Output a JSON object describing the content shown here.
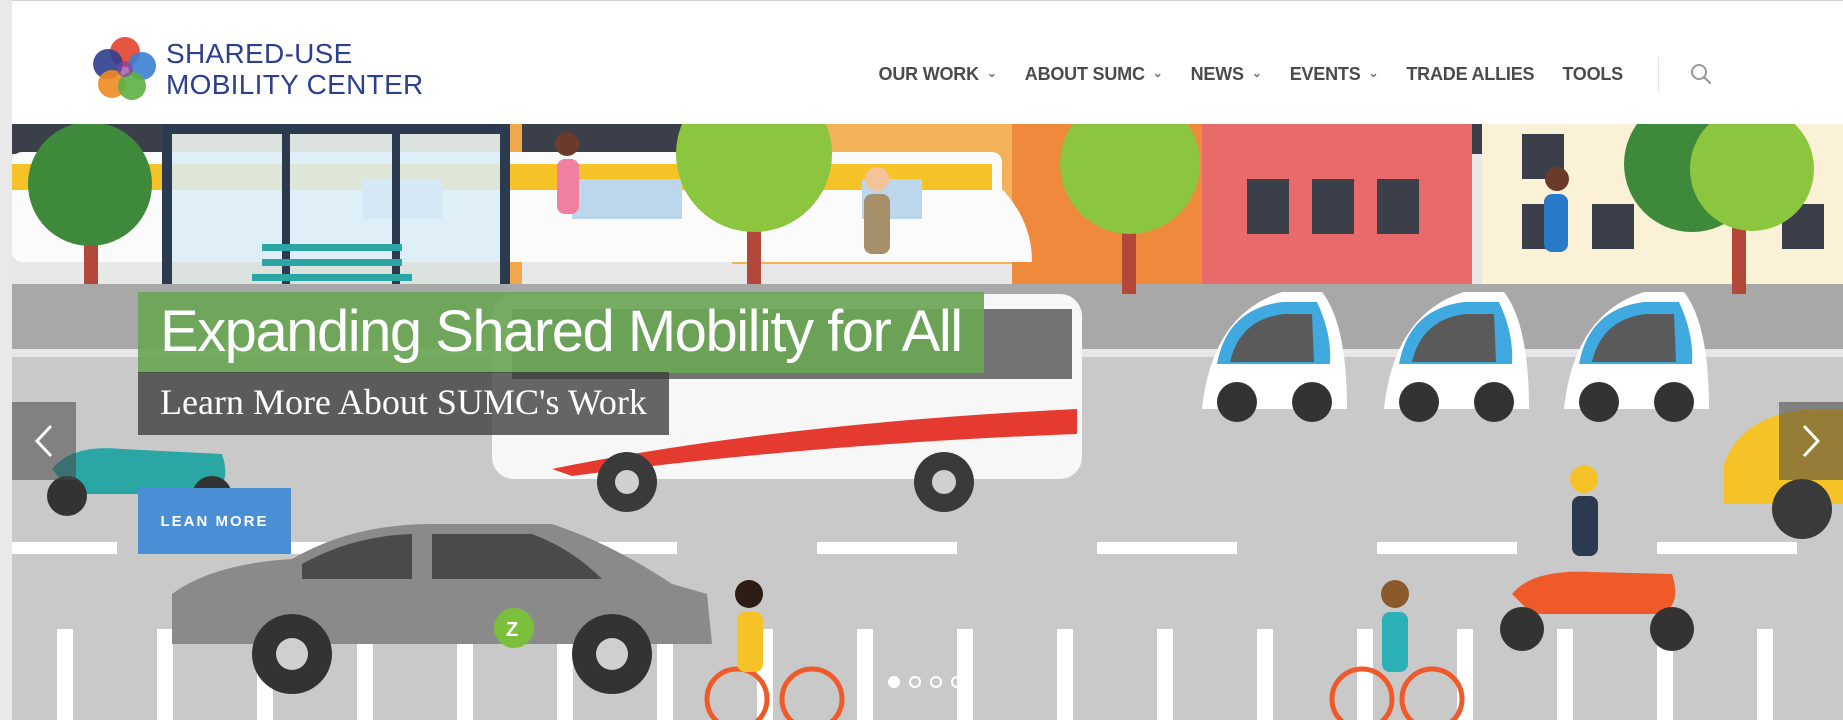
{
  "brand": {
    "line1": "SHARED-USE",
    "line2": "MOBILITY CENTER",
    "logo_colors": [
      "#e2442d",
      "#2d3f8f",
      "#f08a24",
      "#5db043",
      "#3b7fd0"
    ]
  },
  "nav": {
    "items": [
      {
        "label": "OUR WORK",
        "has_dropdown": true
      },
      {
        "label": "ABOUT SUMC",
        "has_dropdown": true
      },
      {
        "label": "NEWS",
        "has_dropdown": true
      },
      {
        "label": "EVENTS",
        "has_dropdown": true
      },
      {
        "label": "TRADE ALLIES",
        "has_dropdown": false
      },
      {
        "label": "TOOLS",
        "has_dropdown": false
      }
    ],
    "chevron": "⌄",
    "search_icon": "search-icon"
  },
  "hero": {
    "headline": "Expanding Shared Mobility for All",
    "subheadline": "Learn More About SUMC's Work",
    "cta_label": "LEAN MORE",
    "prev_icon": "chevron-left-icon",
    "next_icon": "chevron-right-icon",
    "slide_count": 4,
    "active_slide": 1,
    "car_badge": "Z"
  },
  "colors": {
    "brand_text": "#2d3f8f",
    "headline_bg": "#6aa656",
    "cta_bg": "#4a8ed4",
    "road": "#c9c9c9"
  }
}
